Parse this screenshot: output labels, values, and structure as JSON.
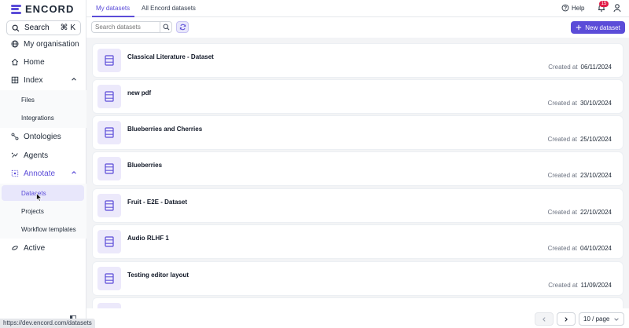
{
  "brand": {
    "name": "ENCORD",
    "color": "#5b4cd8"
  },
  "sidebar": {
    "search_label": "Search",
    "search_shortcut": "⌘ K",
    "items": [
      {
        "label": "My organisation",
        "icon": "globe-icon"
      },
      {
        "label": "Home",
        "icon": "home-icon"
      },
      {
        "label": "Index",
        "icon": "index-icon"
      },
      {
        "label": "Ontologies",
        "icon": "ontology-icon"
      },
      {
        "label": "Agents",
        "icon": "agents-icon"
      },
      {
        "label": "Annotate",
        "icon": "annotate-icon"
      },
      {
        "label": "Active",
        "icon": "active-icon"
      }
    ],
    "index_sub": [
      "Files",
      "Integrations"
    ],
    "annotate_sub": [
      "Datasets",
      "Projects",
      "Workflow templates"
    ]
  },
  "status_url": "https://dev.encord.com/datasets",
  "tabs": [
    "My datasets",
    "All Encord datasets"
  ],
  "header": {
    "help_label": "Help",
    "notification_count": "15"
  },
  "toolbar": {
    "search_placeholder": "Search datasets",
    "new_dataset_label": "New dataset"
  },
  "created_label": "Created at",
  "datasets": [
    {
      "name": "Classical Literature - Dataset",
      "created": "06/11/2024"
    },
    {
      "name": "new pdf",
      "created": "30/10/2024"
    },
    {
      "name": "Blueberries and Cherries",
      "created": "25/10/2024"
    },
    {
      "name": "Blueberries",
      "created": "23/10/2024"
    },
    {
      "name": "Fruit - E2E - Dataset",
      "created": "22/10/2024"
    },
    {
      "name": "Audio RLHF 1",
      "created": "04/10/2024"
    },
    {
      "name": "Testing editor layout",
      "created": "11/09/2024"
    }
  ],
  "pagination": {
    "page_size": "10 / page"
  }
}
